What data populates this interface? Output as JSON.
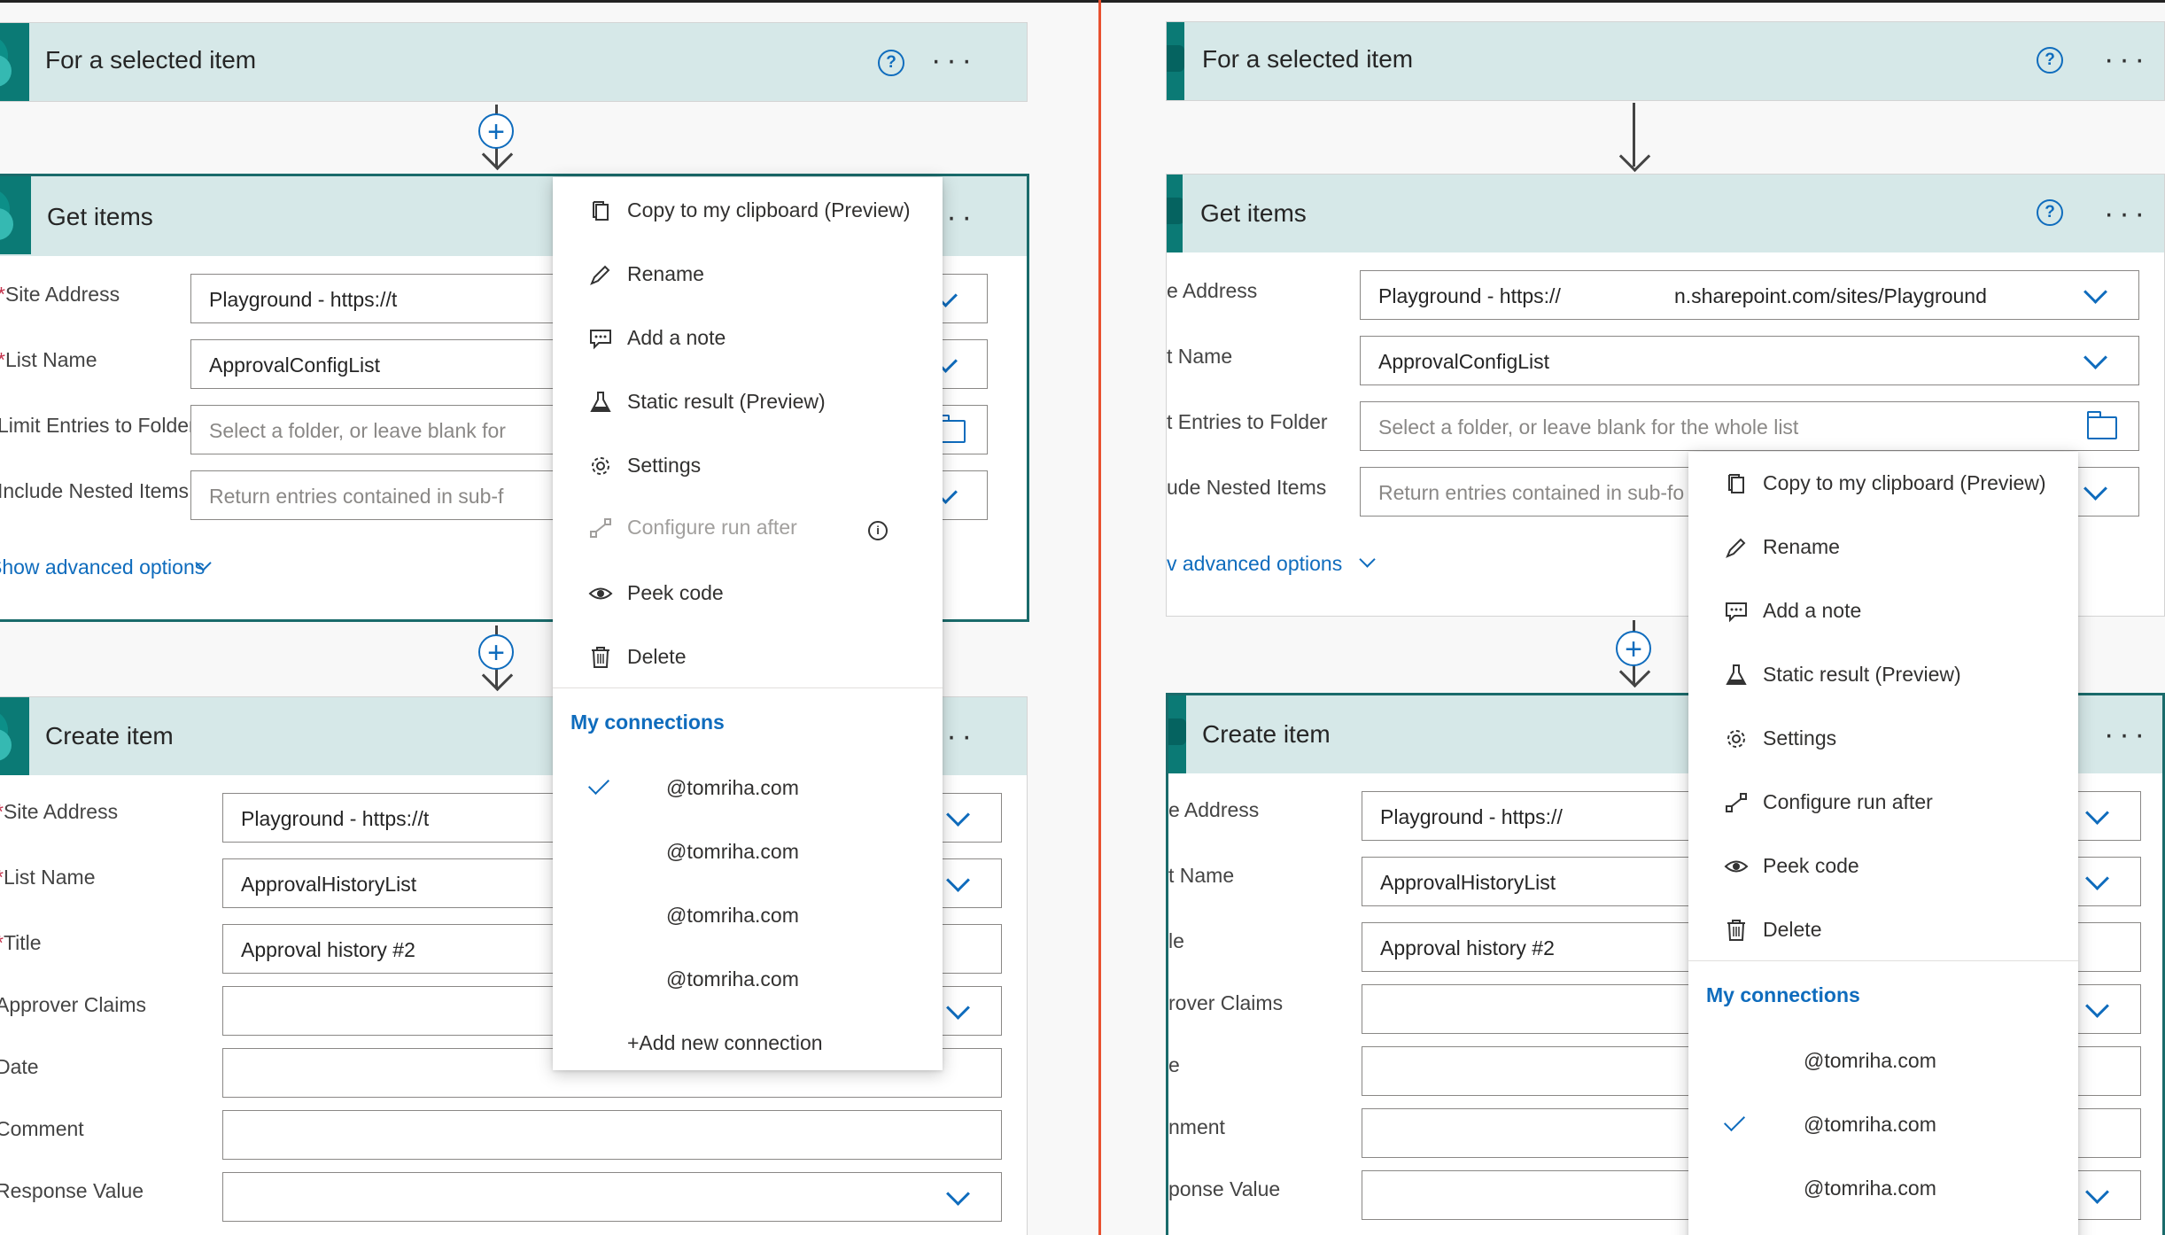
{
  "left": {
    "trigger": {
      "title": "For a selected item",
      "more": "···"
    },
    "get_items": {
      "title": "Get items",
      "more": "···",
      "site_label": "Site Address",
      "site_value": "Playground - https://t",
      "list_label": "List Name",
      "list_value": "ApprovalConfigList",
      "folder_label": "Limit Entries to Folder",
      "folder_placeholder": "Select a folder, or leave blank for",
      "nested_label": "Include Nested Items",
      "nested_placeholder": "Return entries contained in sub-f",
      "advanced": "Show advanced options"
    },
    "create_item": {
      "title": "Create item",
      "more": "···",
      "site_label": "Site Address",
      "site_value": "Playground - https://t",
      "list_label": "List Name",
      "list_value": "ApprovalHistoryList",
      "title_label": "Title",
      "title_value": "Approval history #2",
      "approver_label": "Approver Claims",
      "date_label": "Date",
      "comment_label": "Comment",
      "response_label": "Response Value"
    },
    "menu": {
      "items": [
        "Copy to my clipboard (Preview)",
        "Rename",
        "Add a note",
        "Static result (Preview)",
        "Settings",
        "Configure run after",
        "Peek code",
        "Delete"
      ],
      "connections_header": "My connections",
      "connections": [
        "@tomriha.com",
        "@tomriha.com",
        "@tomriha.com",
        "@tomriha.com"
      ],
      "add_connection": "+Add new connection"
    }
  },
  "right": {
    "trigger": {
      "title": "For a selected item",
      "more": "···"
    },
    "get_items": {
      "title": "Get items",
      "more": "···",
      "site_label": "e Address",
      "site_value": "Playground - https://",
      "site_value_tail": "n.sharepoint.com/sites/Playground",
      "list_label": "t Name",
      "list_value": "ApprovalConfigList",
      "folder_label": "t Entries to Folder",
      "folder_placeholder": "Select a folder, or leave blank for the whole list",
      "nested_label": "ude Nested Items",
      "nested_placeholder": "Return entries contained in sub-fo",
      "advanced": "v advanced options"
    },
    "create_item": {
      "title": "Create item",
      "more": "···",
      "site_label": "e Address",
      "site_value": "Playground - https://",
      "list_label": "t Name",
      "list_value": "ApprovalHistoryList",
      "title_label": "le",
      "title_value": "Approval history #2",
      "approver_label": "rover Claims",
      "date_label": "e",
      "comment_label": "nment",
      "response_label": "ponse Value"
    },
    "menu": {
      "items": [
        "Copy to my clipboard (Preview)",
        "Rename",
        "Add a note",
        "Static result (Preview)",
        "Settings",
        "Configure run after",
        "Peek code",
        "Delete"
      ],
      "connections_header": "My connections",
      "connections": [
        "@tomriha.com",
        "@tomriha.com",
        "@tomriha.com"
      ]
    }
  },
  "colors": {
    "accent": "#0f6cbd",
    "card_header": "#d6e8e8",
    "sharepoint": "#0b7a75",
    "divider": "#e8502f"
  }
}
